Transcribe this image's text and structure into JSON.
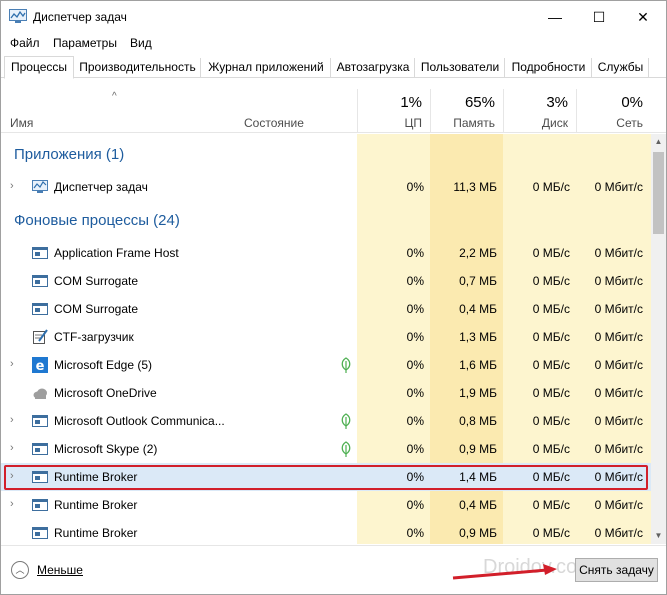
{
  "window": {
    "title": "Диспетчер задач",
    "controls": {
      "minimize": "—",
      "maximize": "☐",
      "close": "✕"
    }
  },
  "menu": [
    "Файл",
    "Параметры",
    "Вид"
  ],
  "tabs": [
    "Процессы",
    "Производительность",
    "Журнал приложений",
    "Автозагрузка",
    "Пользователи",
    "Подробности",
    "Службы"
  ],
  "columns": {
    "name": "Имя",
    "status": "Состояние",
    "cpu": {
      "percent": "1%",
      "label": "ЦП"
    },
    "memory": {
      "percent": "65%",
      "label": "Память"
    },
    "disk": {
      "percent": "3%",
      "label": "Диск"
    },
    "network": {
      "percent": "0%",
      "label": "Сеть"
    }
  },
  "groups": {
    "apps": "Приложения (1)",
    "background": "Фоновые процессы (24)"
  },
  "rows": [
    {
      "name": "Диспетчер задач",
      "icon": "task-manager-icon",
      "expandable": true,
      "eco": false,
      "cpu": "0%",
      "mem": "11,3 МБ",
      "disk": "0 МБ/с",
      "net": "0 Мбит/с"
    },
    {
      "name": "Application Frame Host",
      "icon": "window-icon",
      "expandable": false,
      "eco": false,
      "cpu": "0%",
      "mem": "2,2 МБ",
      "disk": "0 МБ/с",
      "net": "0 Мбит/с"
    },
    {
      "name": "COM Surrogate",
      "icon": "window-icon",
      "expandable": false,
      "eco": false,
      "cpu": "0%",
      "mem": "0,7 МБ",
      "disk": "0 МБ/с",
      "net": "0 Мбит/с"
    },
    {
      "name": "COM Surrogate",
      "icon": "window-icon",
      "expandable": false,
      "eco": false,
      "cpu": "0%",
      "mem": "0,4 МБ",
      "disk": "0 МБ/с",
      "net": "0 Мбит/с"
    },
    {
      "name": "CTF-загрузчик",
      "icon": "ctf-icon",
      "expandable": false,
      "eco": false,
      "cpu": "0%",
      "mem": "1,3 МБ",
      "disk": "0 МБ/с",
      "net": "0 Мбит/с"
    },
    {
      "name": "Microsoft Edge (5)",
      "icon": "edge-icon",
      "expandable": true,
      "eco": true,
      "cpu": "0%",
      "mem": "1,6 МБ",
      "disk": "0 МБ/с",
      "net": "0 Мбит/с"
    },
    {
      "name": "Microsoft OneDrive",
      "icon": "cloud-icon",
      "expandable": false,
      "eco": false,
      "cpu": "0%",
      "mem": "1,9 МБ",
      "disk": "0 МБ/с",
      "net": "0 Мбит/с"
    },
    {
      "name": "Microsoft Outlook Communica...",
      "icon": "window-icon",
      "expandable": true,
      "eco": true,
      "cpu": "0%",
      "mem": "0,8 МБ",
      "disk": "0 МБ/с",
      "net": "0 Мбит/с"
    },
    {
      "name": "Microsoft Skype (2)",
      "icon": "window-icon",
      "expandable": true,
      "eco": true,
      "cpu": "0%",
      "mem": "0,9 МБ",
      "disk": "0 МБ/с",
      "net": "0 Мбит/с"
    },
    {
      "name": "Runtime Broker",
      "icon": "window-icon",
      "expandable": true,
      "eco": false,
      "cpu": "0%",
      "mem": "1,4 МБ",
      "disk": "0 МБ/с",
      "net": "0 Мбит/с",
      "selected": true
    },
    {
      "name": "Runtime Broker",
      "icon": "window-icon",
      "expandable": true,
      "eco": false,
      "cpu": "0%",
      "mem": "0,4 МБ",
      "disk": "0 МБ/с",
      "net": "0 Мбит/с"
    },
    {
      "name": "Runtime Broker",
      "icon": "window-icon",
      "expandable": false,
      "eco": false,
      "cpu": "0%",
      "mem": "0,9 МБ",
      "disk": "0 МБ/с",
      "net": "0 Мбит/с"
    }
  ],
  "footer": {
    "less_label": "Меньше",
    "end_task_label": "Снять задачу",
    "watermark": "Droidov.com"
  },
  "colors": {
    "group_title": "#1e5c9e",
    "cpu_bg": "#fdf5cf",
    "mem_bg": "#fbeab0",
    "selection": "#dbe9f7",
    "highlight": "#d21f2a"
  }
}
